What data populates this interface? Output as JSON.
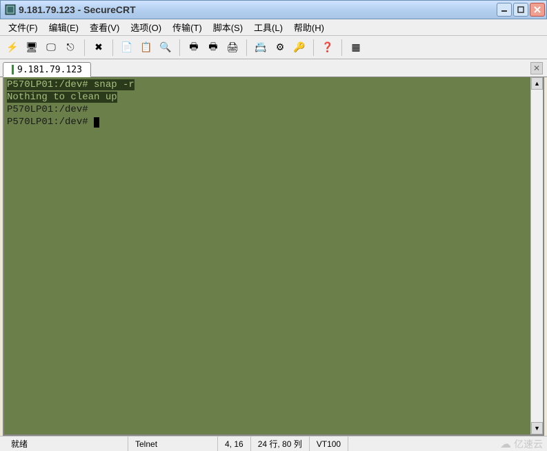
{
  "window": {
    "title": "9.181.79.123 - SecureCRT"
  },
  "menu": {
    "items": [
      {
        "label": "文件(F)"
      },
      {
        "label": "编辑(E)"
      },
      {
        "label": "查看(V)"
      },
      {
        "label": "选项(O)"
      },
      {
        "label": "传输(T)"
      },
      {
        "label": "脚本(S)"
      },
      {
        "label": "工具(L)"
      },
      {
        "label": "帮助(H)"
      }
    ]
  },
  "toolbar": {
    "icons": [
      "quick-connect-icon",
      "connect-icon",
      "reconnect-icon",
      "disconnect-icon",
      "sep",
      "delete-icon",
      "sep",
      "copy-icon",
      "paste-icon",
      "find-icon",
      "sep",
      "print-screen-icon",
      "print-selection-icon",
      "print-icon",
      "sep",
      "properties-icon",
      "options-icon",
      "key-icon",
      "sep",
      "help-icon",
      "sep",
      "toggle-icon"
    ],
    "glyphs": {
      "quick-connect-icon": "⚡",
      "connect-icon": "🖥",
      "reconnect-icon": "🖵",
      "disconnect-icon": "⎋",
      "delete-icon": "✖",
      "copy-icon": "📄",
      "paste-icon": "📋",
      "find-icon": "🔍",
      "print-screen-icon": "🖶",
      "print-selection-icon": "🖶",
      "print-icon": "🖨",
      "properties-icon": "📇",
      "options-icon": "⚙",
      "key-icon": "🔑",
      "help-icon": "❓",
      "toggle-icon": "▦"
    }
  },
  "tabs": {
    "active": "9.181.79.123"
  },
  "terminal": {
    "lines": [
      {
        "hl": true,
        "text": "P570LP01:/dev# snap -r"
      },
      {
        "hl": true,
        "text": "Nothing to clean up"
      },
      {
        "hl": false,
        "text": "P570LP01:/dev#"
      },
      {
        "hl": false,
        "text": "P570LP01:/dev# ",
        "cursor": true
      }
    ]
  },
  "status": {
    "ready": "就绪",
    "protocol": "Telnet",
    "pos": "4, 16",
    "size": "24 行, 80 列",
    "emu": "VT100",
    "watermark": "亿速云"
  }
}
